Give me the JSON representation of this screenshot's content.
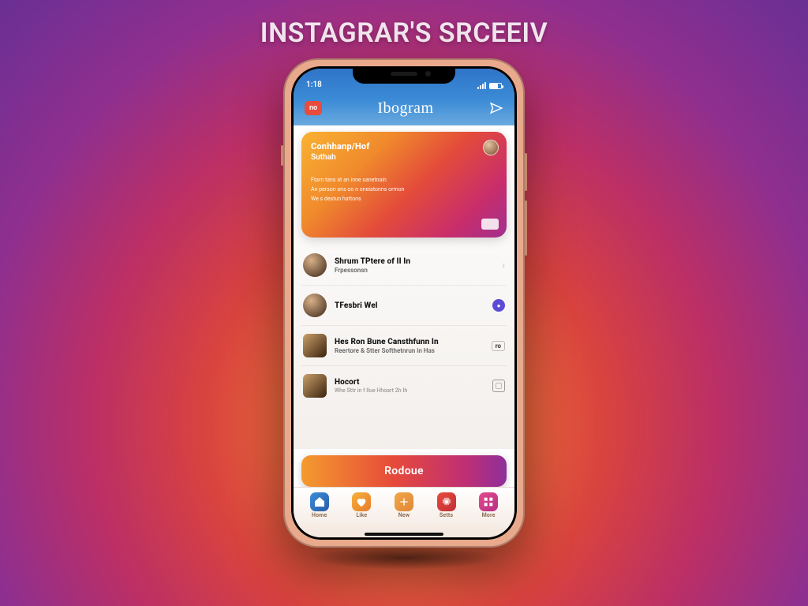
{
  "headline": "INSTAGRAR'S SRCEEIV",
  "statusbar": {
    "time": "1:18"
  },
  "appbar": {
    "badge": "no",
    "brand": "Ibogram"
  },
  "hero": {
    "title": "Conhhanp/Hof",
    "subtitle": "Suthah",
    "body1": "Ftarn tans at an inne sanetnain",
    "body2": "An person ans oo n oneiatonns ormon",
    "body3": "We s destun hattons"
  },
  "rows": [
    {
      "title": "Shrum TPtere of II In",
      "sub": "Frpessonsn",
      "trail_type": "arrow"
    },
    {
      "title": "TFesbri Wel",
      "sub": "",
      "trail_type": "dot",
      "trail_value": "●"
    },
    {
      "title": "Hes Ron Bune Cansthfunn In",
      "sub": "Reertore & Stter Softhetnrun in Has",
      "trail_type": "pill",
      "trail_value": "ro"
    },
    {
      "title": "Hocort",
      "sub": "Whe Sttr in f Ilue Hhoart 2h Ih",
      "trail_type": "box"
    }
  ],
  "cta": {
    "label": "Rodoue"
  },
  "tabs": [
    {
      "label": "Home",
      "color": "blue"
    },
    {
      "label": "Like",
      "color": "amber"
    },
    {
      "label": "New",
      "color": "amber2"
    },
    {
      "label": "Setts",
      "color": "red"
    },
    {
      "label": "More",
      "color": "pink"
    }
  ]
}
